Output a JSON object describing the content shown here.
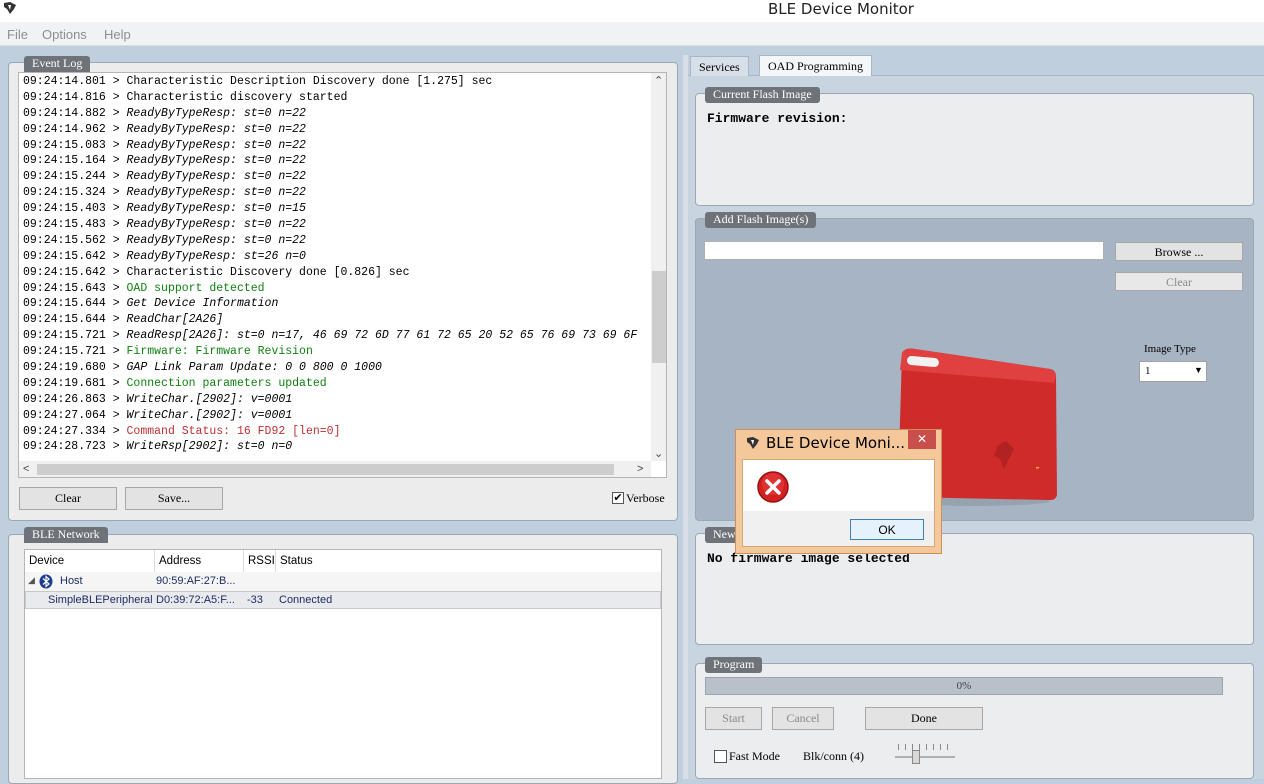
{
  "window": {
    "title": "BLE Device Monitor"
  },
  "menu": [
    "File",
    "Options",
    "Help"
  ],
  "event_log": {
    "label": "Event Log",
    "lines": [
      {
        "t": "09:24:14.801 > ",
        "m": "Characteristic Description Discovery done [1.275] sec",
        "style": ""
      },
      {
        "t": "09:24:14.816 > ",
        "m": "Characteristic discovery started",
        "style": ""
      },
      {
        "t": "09:24:14.882 > ",
        "m": "ReadyByTypeResp: st=0 n=22",
        "style": "it"
      },
      {
        "t": "09:24:14.962 > ",
        "m": "ReadyByTypeResp: st=0 n=22",
        "style": "it"
      },
      {
        "t": "09:24:15.083 > ",
        "m": "ReadyByTypeResp: st=0 n=22",
        "style": "it"
      },
      {
        "t": "09:24:15.164 > ",
        "m": "ReadyByTypeResp: st=0 n=22",
        "style": "it"
      },
      {
        "t": "09:24:15.244 > ",
        "m": "ReadyByTypeResp: st=0 n=22",
        "style": "it"
      },
      {
        "t": "09:24:15.324 > ",
        "m": "ReadyByTypeResp: st=0 n=22",
        "style": "it"
      },
      {
        "t": "09:24:15.403 > ",
        "m": "ReadyByTypeResp: st=0 n=15",
        "style": "it"
      },
      {
        "t": "09:24:15.483 > ",
        "m": "ReadyByTypeResp: st=0 n=22",
        "style": "it"
      },
      {
        "t": "09:24:15.562 > ",
        "m": "ReadyByTypeResp: st=0 n=22",
        "style": "it"
      },
      {
        "t": "09:24:15.642 > ",
        "m": "ReadyByTypeResp: st=26 n=0",
        "style": "it"
      },
      {
        "t": "09:24:15.642 > ",
        "m": "Characteristic Discovery done [0.826] sec",
        "style": ""
      },
      {
        "t": "09:24:15.643 > ",
        "m": "OAD support detected",
        "style": "green"
      },
      {
        "t": "09:24:15.644 > ",
        "m": "Get Device Information",
        "style": "it"
      },
      {
        "t": "09:24:15.644 > ",
        "m": "ReadChar[2A26]",
        "style": "it"
      },
      {
        "t": "09:24:15.721 > ",
        "m": "ReadResp[2A26]: st=0 n=17, 46 69 72 6D 77 61 72 65 20 52 65 76 69 73 69 6F",
        "style": "it"
      },
      {
        "t": "09:24:15.721 > ",
        "m": "Firmware: Firmware Revision",
        "style": "green"
      },
      {
        "t": "09:24:19.680 > ",
        "m": "GAP Link Param Update: 0 0 800 0 1000",
        "style": "it"
      },
      {
        "t": "09:24:19.681 > ",
        "m": "Connection parameters updated",
        "style": "green"
      },
      {
        "t": "09:24:26.863 > ",
        "m": "WriteChar.[2902]: v=0001",
        "style": "it"
      },
      {
        "t": "09:24:27.064 > ",
        "m": "WriteChar.[2902]: v=0001",
        "style": "it"
      },
      {
        "t": "09:24:27.334 > ",
        "m": "Command Status: 16 FD92 [len=0]",
        "style": "red"
      },
      {
        "t": "09:24:28.723 > ",
        "m": "WriteRsp[2902]: st=0 n=0",
        "style": "it"
      }
    ],
    "clear_label": "Clear",
    "save_label": "Save...",
    "verbose_label": "Verbose",
    "verbose_checked": true
  },
  "ble_network": {
    "label": "BLE Network",
    "columns": [
      "Device",
      "Address",
      "RSSI",
      "Status"
    ],
    "rows": [
      {
        "device": "Host",
        "address": "90:59:AF:27:B...",
        "rssi": "",
        "status": ""
      },
      {
        "device": "SimpleBLEPeripheral",
        "address": "D0:39:72:A5:F...",
        "rssi": "-33",
        "status": "Connected"
      }
    ]
  },
  "tabs": [
    "Services",
    "OAD Programming"
  ],
  "active_tab": "OAD Programming",
  "current_flash": {
    "label": "Current Flash Image",
    "firmware_revision_label": "Firmware revision:"
  },
  "add_flash": {
    "label": "Add Flash Image(s)",
    "path_value": "",
    "browse_label": "Browse ...",
    "clear_label": "Clear",
    "image_type_label": "Image Type",
    "image_type_value": "1"
  },
  "new_image": {
    "label": "New",
    "message": "No firmware image selected"
  },
  "program": {
    "label": "Program",
    "progress_percent": 0,
    "progress_text": "0%",
    "start_label": "Start",
    "cancel_label": "Cancel",
    "done_label": "Done",
    "fast_mode_label": "Fast Mode",
    "fast_mode_checked": false,
    "blk_label": "Blk/conn (4)"
  },
  "dialog": {
    "title": "BLE Device Moni...",
    "ok_label": "OK",
    "icon": "error-icon"
  },
  "colors": {
    "accent_tab": "#6e7279",
    "error": "#c03030",
    "success": "#108010",
    "product": "#cf2b2b"
  }
}
